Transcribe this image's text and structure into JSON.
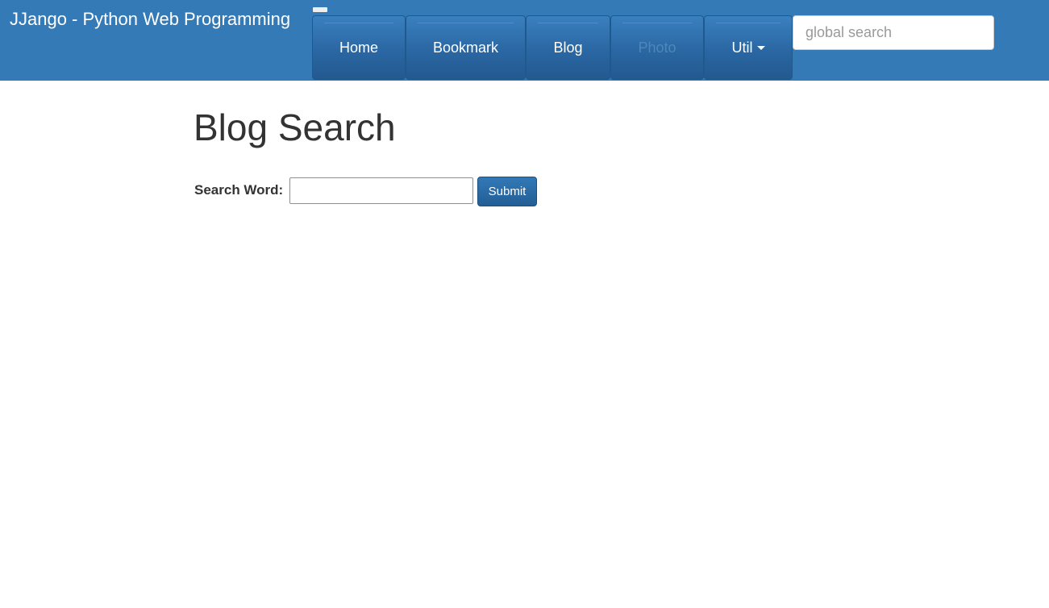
{
  "navbar": {
    "brand": "JJango - Python Web Programming",
    "items": [
      {
        "label": "Home",
        "disabled": false
      },
      {
        "label": "Bookmark",
        "disabled": false
      },
      {
        "label": "Blog",
        "disabled": false
      },
      {
        "label": "Photo",
        "disabled": true
      },
      {
        "label": "Util",
        "disabled": false,
        "dropdown": true
      }
    ],
    "search_placeholder": "global search",
    "toggle_icon": "menu-toggle-icon"
  },
  "main": {
    "title": "Blog Search",
    "form": {
      "label": "Search Word:",
      "input_value": "",
      "submit_label": "Submit"
    }
  },
  "colors": {
    "navbar_bg": "#337ab7",
    "button_bg": "#286090",
    "text": "#333333"
  }
}
